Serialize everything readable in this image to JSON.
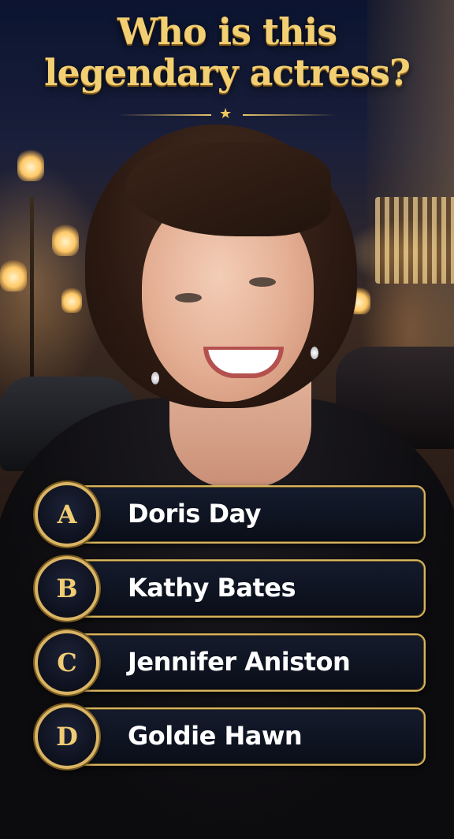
{
  "question": {
    "line1": "Who is this",
    "line2": "legendary actress?"
  },
  "divider_icon": "star-icon",
  "answers": [
    {
      "letter": "A",
      "text": "Doris Day"
    },
    {
      "letter": "B",
      "text": "Kathy Bates"
    },
    {
      "letter": "C",
      "text": "Jennifer Aniston"
    },
    {
      "letter": "D",
      "text": "Goldie Hawn"
    }
  ],
  "colors": {
    "gold": "#f3cf73",
    "option_bg": "#0a0e18",
    "option_border": "#d7b45e"
  }
}
